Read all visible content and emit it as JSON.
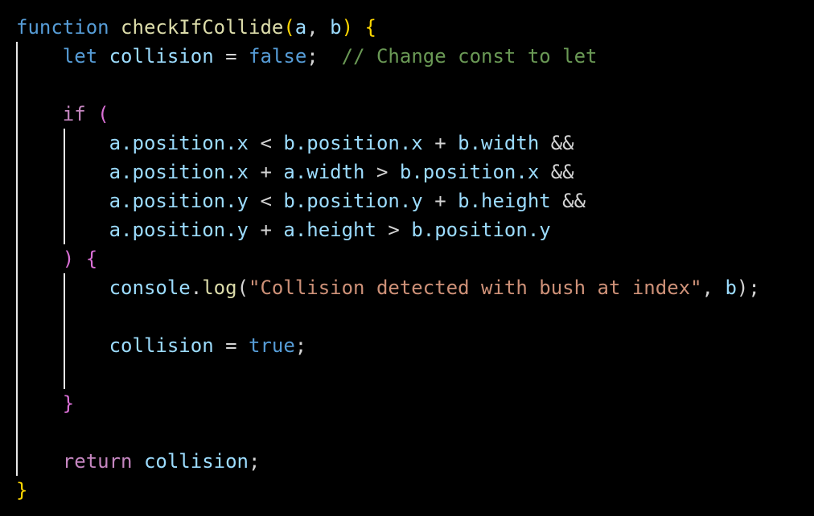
{
  "editor": {
    "line1": {
      "keyword": "function",
      "name": "checkIfCollide",
      "open_paren": "(",
      "param_a": "a",
      "comma": ", ",
      "param_b": "b",
      "close_paren": ")",
      "open_brace": "{"
    },
    "line2": {
      "keyword": "let",
      "variable": "collision",
      "operator": " = ",
      "value": "false",
      "semicolon": ";",
      "comment": "// Change const to let"
    },
    "line4": {
      "keyword": "if",
      "paren": "("
    },
    "line5": {
      "obj1": "a",
      "prop1": ".position.x",
      "op1": " < ",
      "obj2": "b",
      "prop2": ".position.x",
      "op2": " + ",
      "obj3": "b",
      "prop3": ".width",
      "op3": " &&"
    },
    "line6": {
      "obj1": "a",
      "prop1": ".position.x",
      "op1": " + ",
      "obj2": "a",
      "prop2": ".width",
      "op2": " > ",
      "obj3": "b",
      "prop3": ".position.x",
      "op3": " &&"
    },
    "line7": {
      "obj1": "a",
      "prop1": ".position.y",
      "op1": " < ",
      "obj2": "b",
      "prop2": ".position.y",
      "op2": " + ",
      "obj3": "b",
      "prop3": ".height",
      "op3": " &&"
    },
    "line8": {
      "obj1": "a",
      "prop1": ".position.y",
      "op1": " + ",
      "obj2": "a",
      "prop2": ".height",
      "op2": " > ",
      "obj3": "b",
      "prop3": ".position.y"
    },
    "line9": {
      "close_paren": ")",
      "open_brace": "{"
    },
    "line10": {
      "object": "console",
      "dot": ".",
      "method": "log",
      "open_paren": "(",
      "string": "\"Collision detected with bush at index\"",
      "comma": ", ",
      "arg": "b",
      "close": ");"
    },
    "line12": {
      "variable": "collision",
      "operator": " = ",
      "value": "true",
      "semicolon": ";"
    },
    "line14": {
      "close_brace": "}"
    },
    "line16": {
      "keyword": "return",
      "variable": "collision",
      "semicolon": ";"
    },
    "line17": {
      "close_brace": "}"
    }
  },
  "colors": {
    "background": "#000000",
    "keyword_declaration": "#569cd6",
    "keyword_control": "#c586c0",
    "function_name": "#dcdcaa",
    "variable": "#9cdcfe",
    "string": "#ce9178",
    "comment": "#6a9955",
    "bracket_level1": "#ffd700",
    "bracket_level2": "#da70d6"
  }
}
